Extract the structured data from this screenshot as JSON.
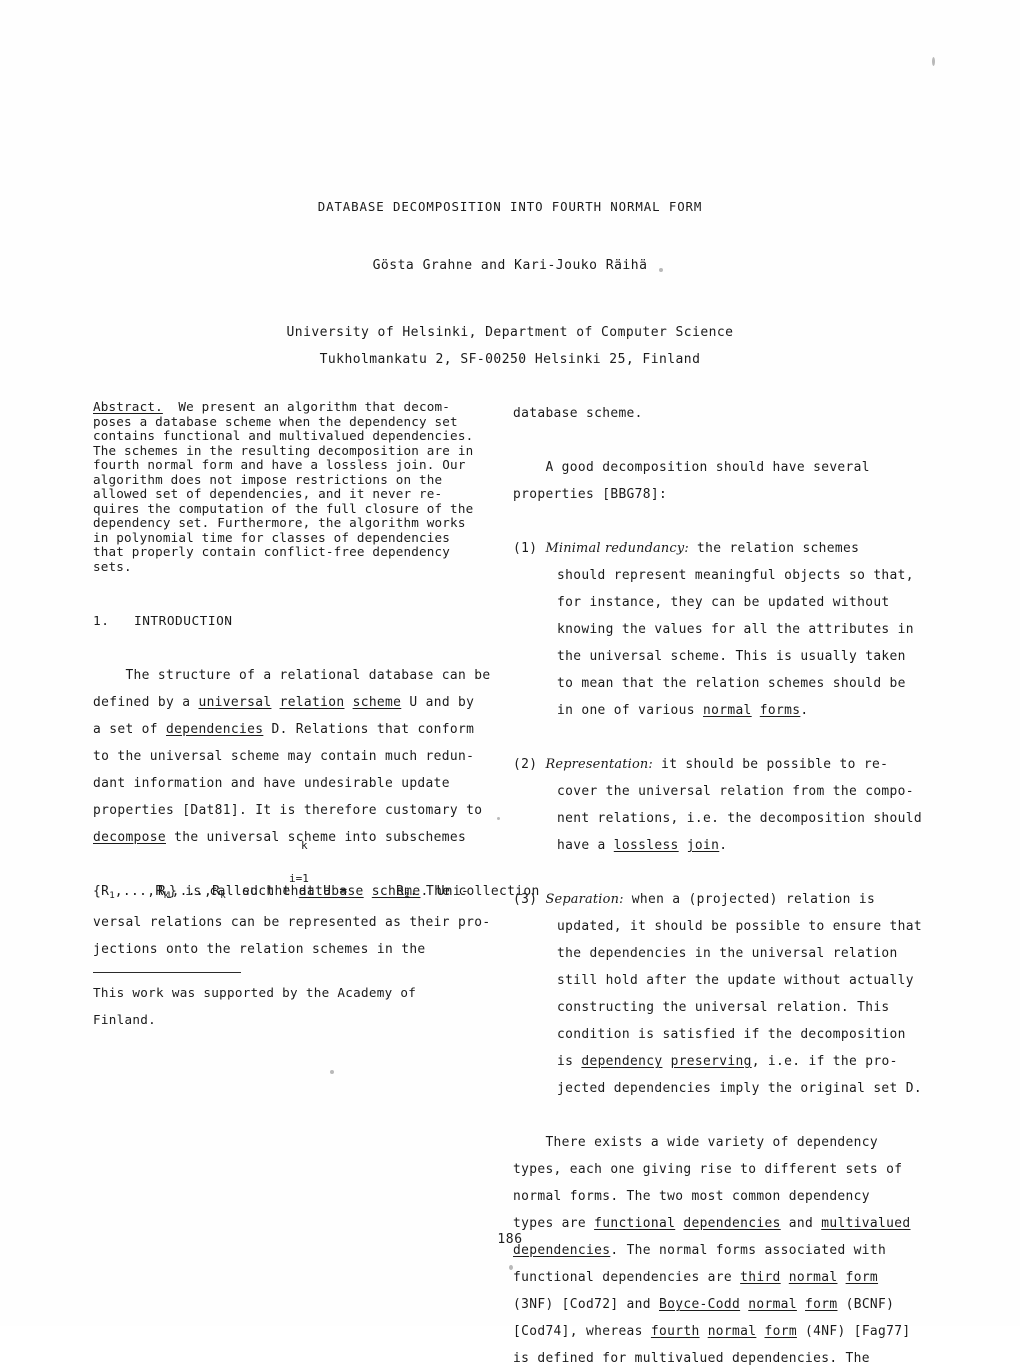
{
  "header": {
    "title": "DATABASE DECOMPOSITION INTO FOURTH NORMAL FORM",
    "authors": "Gösta Grahne and Kari-Jouko Räihä",
    "affiliation_line1": "University of Helsinki, Department of Computer Science",
    "affiliation_line2": "Tukholmankatu 2, SF-00250 Helsinki 25, Finland"
  },
  "abstract": {
    "label": "Abstract.",
    "lines": [
      "  We present an algorithm that decom-",
      "poses a database scheme when the dependency set",
      "contains functional and multivalued dependencies.",
      "The schemes in the resulting decomposition are in",
      "fourth normal form and have a lossless join. Our",
      "algorithm does not impose restrictions on the",
      "allowed set of dependencies, and it never re-",
      "quires the computation of the full closure of the",
      "dependency set. Furthermore, the algorithm works",
      "in polynomial time for classes of dependencies",
      "that properly contain conflict-free dependency",
      "sets."
    ]
  },
  "introduction": {
    "heading": "1.   INTRODUCTION",
    "para1": {
      "l1_a": "    The structure of a relational database can be",
      "l2_a": "defined by a ",
      "l2_u1": "universal",
      "l2_b": " ",
      "l2_u2": "relation",
      "l2_c": " ",
      "l2_u3": "scheme",
      "l2_d": " U and by",
      "l3_a": "a set of ",
      "l3_u1": "dependencies",
      "l3_b": " D. Relations that conform",
      "l4": "to the universal scheme may contain much redun-",
      "l5": "dant information and have undesirable update",
      "l6": "properties [Dat81]. It is therefore customary to",
      "l7_u1": "decompose",
      "l7_b": " the universal scheme into subschemes",
      "math_prefix": "R",
      "math_sub1": "1",
      "math_mid": ",...,R",
      "math_sub2": "k",
      "math_after": "  such that U =      R",
      "math_sub3": "i",
      "math_tail": ". The collection",
      "math_limit_top": "k",
      "math_limit_bot": "i=1",
      "math_union": "U",
      "l9_a": "{R",
      "l9_sub1": "1",
      "l9_b": ",...,R",
      "l9_sub2": "k",
      "l9_c": "} is called the ",
      "l9_u1": "database",
      "l9_d": " ",
      "l9_u2": "scheme",
      "l9_e": ". Uni-",
      "l10": "versal relations can be represented as their pro-",
      "l11": "jections onto the relation schemes in the"
    }
  },
  "footnote": {
    "line1": "This work was supported by the Academy of",
    "line2": "Finland."
  },
  "right_column": {
    "continuation": "database scheme.",
    "para_intro": {
      "l1": "    A good decomposition should have several",
      "l2": "properties [BBG78]:"
    },
    "items": [
      {
        "number": "(1)",
        "label": "Minimal redundancy:",
        "first_rest": " the relation schemes",
        "lines": [
          "should represent meaningful objects so that,",
          "for instance, they can be updated without",
          "knowing the values for all the attributes in",
          "the universal scheme. This is usually taken",
          "to mean that the relation schemes should be"
        ],
        "last_line_pre": "in one of various ",
        "last_line_u1": "normal",
        "last_line_mid": " ",
        "last_line_u2": "forms",
        "last_line_post": "."
      },
      {
        "number": "(2)",
        "label": "Representation:",
        "first_rest": " it should be possible to re-",
        "lines": [
          "cover the universal relation from the compo-",
          "nent relations, i.e. the decomposition should"
        ],
        "last_line_pre": "have a ",
        "last_line_u1": "lossless",
        "last_line_mid": " ",
        "last_line_u2": "join",
        "last_line_post": "."
      },
      {
        "number": "(3)",
        "label": "Separation:",
        "first_rest": " when a (projected) relation is",
        "lines": [
          "updated, it should be possible to ensure that",
          "the dependencies in the universal relation",
          "still hold after the update without actually",
          "constructing the universal relation. This",
          "condition is satisfied if the decomposition"
        ],
        "pre_u_line_a": "is ",
        "pre_u_line_u1": "dependency",
        "pre_u_line_mid": " ",
        "pre_u_line_u2": "preserving",
        "pre_u_line_post": ", i.e. if the pro-",
        "last_line_pre": "jected dependencies imply the original set D.",
        "last_line_u1": "",
        "last_line_mid": "",
        "last_line_u2": "",
        "last_line_post": ""
      }
    ],
    "final_para": {
      "l1": "    There exists a wide variety of dependency",
      "l2": "types, each one giving rise to different sets of",
      "l3": "normal forms. The two most common dependency",
      "l4_a": "types are ",
      "l4_u1": "functional",
      "l4_b": " ",
      "l4_u2": "dependencies",
      "l4_c": " and ",
      "l4_u3": "multivalued",
      "l5_u1": "dependencies",
      "l5_a": ". The normal forms associated with",
      "l6_a": "functional dependencies are ",
      "l6_u1": "third",
      "l6_b": " ",
      "l6_u2": "normal",
      "l6_c": " ",
      "l6_u3": "form",
      "l7_a": "(3NF) [Cod72] and ",
      "l7_u1": "Boyce-Codd",
      "l7_b": " ",
      "l7_u2": "normal",
      "l7_c": " ",
      "l7_u3": "form",
      "l7_d": " (BCNF)",
      "l8_a": "[Cod74], whereas ",
      "l8_u1": "fourth",
      "l8_b": " ",
      "l8_u2": "normal",
      "l8_c": " ",
      "l8_u3": "form",
      "l8_d": " (4NF) [Fag77]",
      "l9": "is defined for multivalued dependencies. The"
    }
  },
  "page_number": "186"
}
